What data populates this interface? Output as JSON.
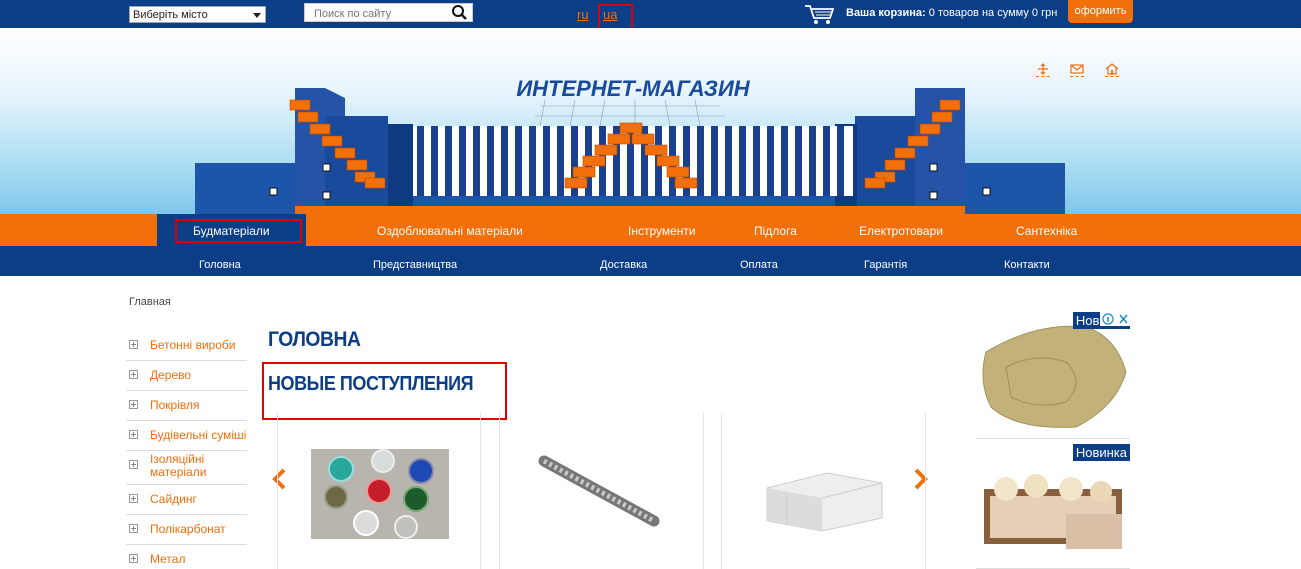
{
  "topbar": {
    "city_select": "Виберіть місто",
    "search_placeholder": "Поиск по сайту",
    "lang_ru": "ru",
    "lang_ua": "ua",
    "cart_label": "Ваша корзина:",
    "cart_summary": "0 товаров на сумму 0 грн",
    "checkout_button": "оформить"
  },
  "banner": {
    "logo_text": "ИНТЕРНЕТ-МАГАЗИН"
  },
  "category_nav": [
    {
      "label": "Будматеріали",
      "active": true
    },
    {
      "label": "Оздоблювальні матеріали"
    },
    {
      "label": "Інструменти"
    },
    {
      "label": "Підлога"
    },
    {
      "label": "Електротовари"
    },
    {
      "label": "Сантехніка"
    }
  ],
  "sub_nav": [
    "Головна",
    "Представництва",
    "Доставка",
    "Оплата",
    "Гарантія",
    "Контакти"
  ],
  "breadcrumb": "Главная",
  "sidebar": [
    "Бетонні вироби",
    "Дерево",
    "Покрівля",
    "Будівельні суміші",
    "Ізоляційні матеріали",
    "Сайдинг",
    "Полікарбонат",
    "Метал"
  ],
  "main": {
    "page_title": "ГОЛОВНА",
    "section_title": "НОВЫЕ ПОСТУПЛЕНИЯ"
  },
  "ads": [
    {
      "badge": "Новинка"
    },
    {
      "badge": "Новинка"
    }
  ],
  "colors": {
    "brand_blue": "#0b3e86",
    "brand_orange": "#f26f0a",
    "highlight_red": "#e00000"
  }
}
